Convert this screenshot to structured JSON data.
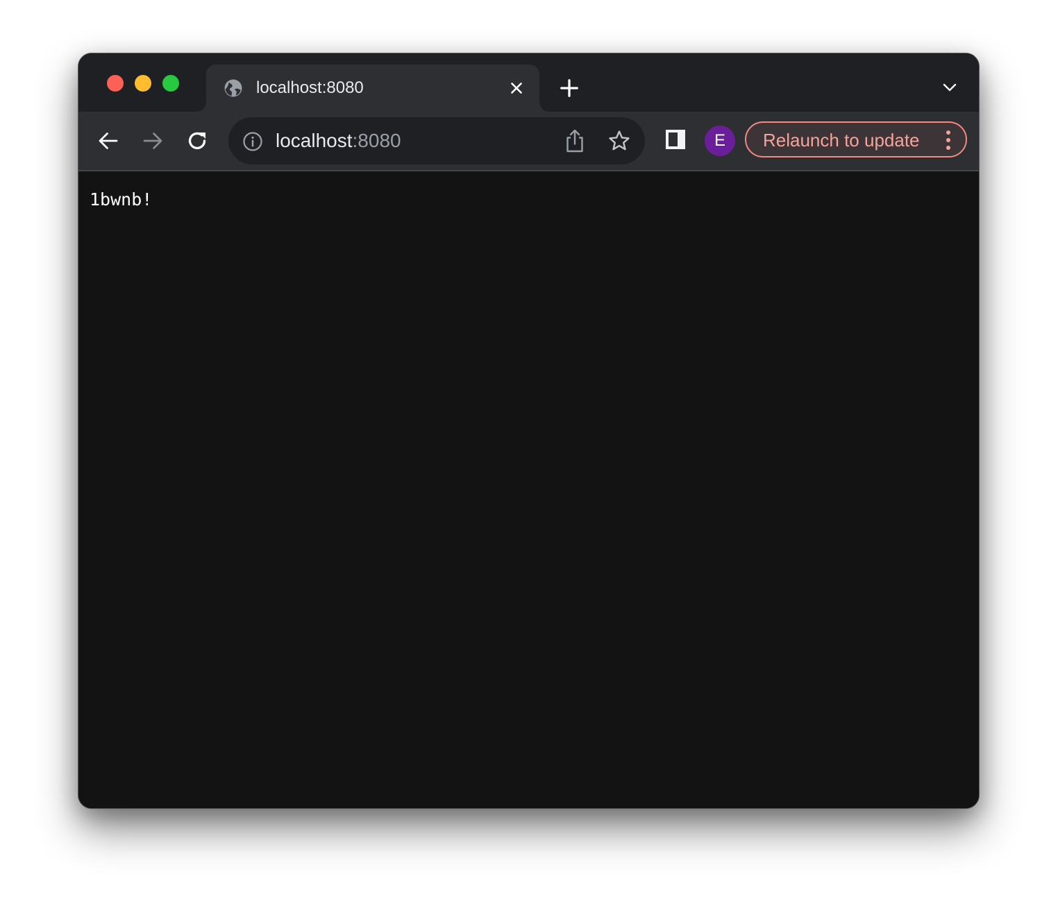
{
  "window": {
    "traffic_lights": [
      "close",
      "minimize",
      "maximize"
    ]
  },
  "tabs": [
    {
      "title": "localhost:8080",
      "favicon": "globe-icon",
      "active": true
    }
  ],
  "toolbar": {
    "url_host": "localhost",
    "url_port": ":8080",
    "avatar_initial": "E",
    "relaunch_label": "Relaunch to update",
    "colors": {
      "avatar": "#6b1e9a",
      "relaunch_accent": "#f28b82"
    }
  },
  "page": {
    "text": "1bwnb!"
  }
}
